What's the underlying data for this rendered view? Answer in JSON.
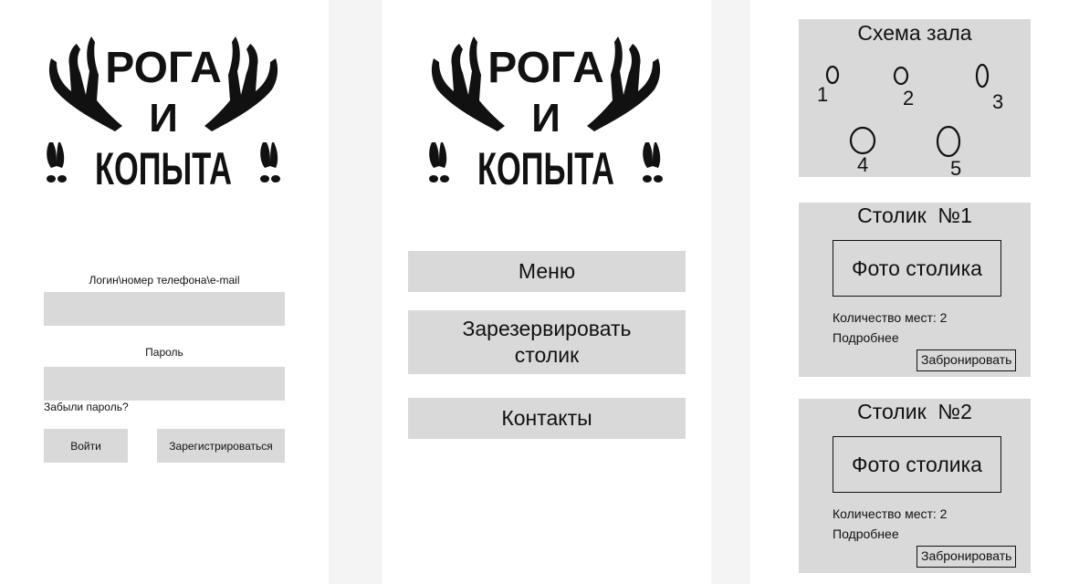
{
  "logo": {
    "line1": "РОГА",
    "line2": "И",
    "line3": "КОПЫТА"
  },
  "login": {
    "login_label": "Логин\\номер телефона\\e-mail",
    "password_label": "Пароль",
    "forgot": "Забыли пароль?",
    "login_button": "Войти",
    "register_button": "Зарегистрироваться"
  },
  "menu": {
    "items": [
      {
        "label": "Меню"
      },
      {
        "label": "Зарезервировать\nстолик"
      },
      {
        "label": "Контакты"
      }
    ]
  },
  "hall": {
    "title": "Схема зала",
    "tables": [
      "1",
      "2",
      "3",
      "4",
      "5"
    ]
  },
  "tables": [
    {
      "title": "Столик  №1",
      "photo": "Фото столика",
      "seats": "Количество мест: 2",
      "more": "Подробнее",
      "book": "Забронировать"
    },
    {
      "title": "Столик  №2",
      "photo": "Фото столика",
      "seats": "Количество мест: 2",
      "more": "Подробнее",
      "book": "Забронировать"
    }
  ],
  "colors": {
    "panel": "#d9d9d9",
    "gutter": "#f4f4f4",
    "ink": "#111111"
  }
}
